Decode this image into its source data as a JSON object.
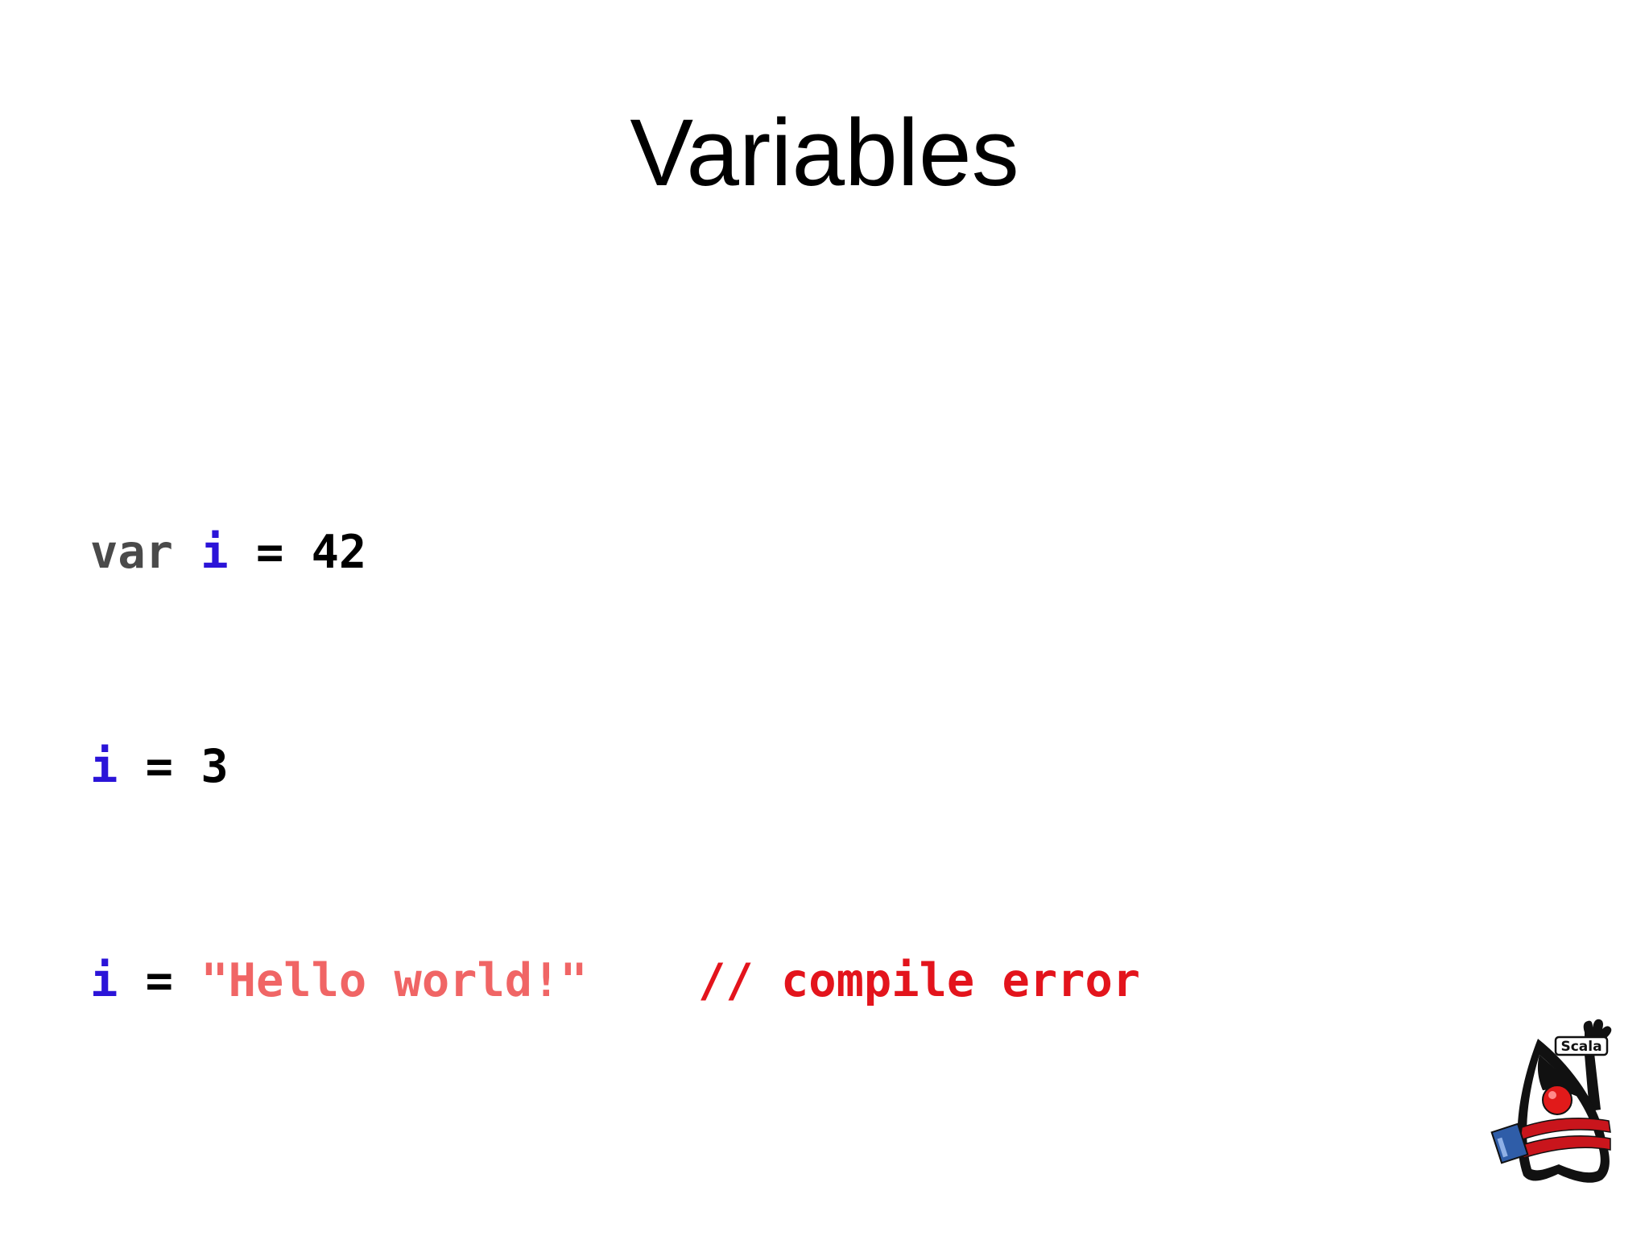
{
  "slide": {
    "title": "Variables"
  },
  "code": {
    "line1": {
      "keyword": "var",
      "ident": "i",
      "op": "=",
      "value": "42"
    },
    "line2": {
      "ident": "i",
      "op": "=",
      "value": "3"
    },
    "line3": {
      "ident": "i",
      "op": "=",
      "string": "\"Hello world!\"",
      "comment": "// compile error"
    }
  },
  "logo": {
    "badge_text": "Scala",
    "icon": "scala-duke-mascot-icon"
  },
  "colors": {
    "keyword": "#4a4a4a",
    "identifier": "#2b14d8",
    "string": "#f06565",
    "comment": "#e3141c"
  }
}
